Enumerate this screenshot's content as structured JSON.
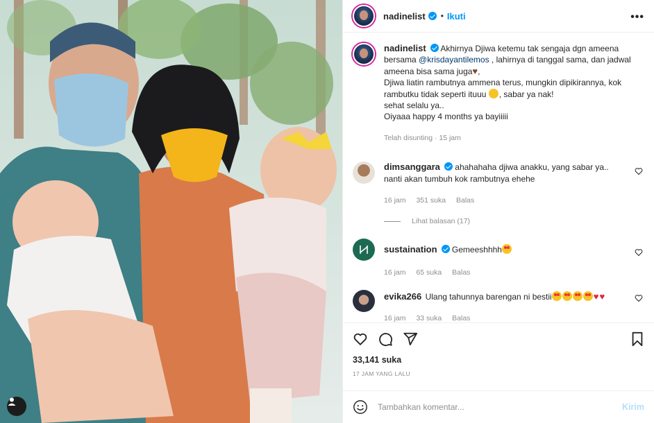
{
  "post": {
    "username": "nadinelist",
    "follow_label": "Ikuti",
    "separator": "•",
    "more_label": "•••"
  },
  "caption": {
    "username": "nadinelist",
    "text_1": "Akhirnya Djiwa ketemu tak sengaja dgn ameena bersama ",
    "mention": "@krisdayantilemos",
    "text_2": " , lahirnya di tanggal sama, dan jadwal ameena bisa sama juga",
    "line_2_a": "Djiwa liatin rambutnya ammena terus, mungkin dipikirannya, kok rambutku tidak seperti ituuu ",
    "line_2_b": ", sabar ya nak!",
    "line_3": "sehat selalu ya..",
    "line_4": "Oiyaaa happy 4 months ya bayiiiii",
    "edited": "Telah disunting · 15 jam"
  },
  "comments": [
    {
      "username": "dimsanggara",
      "verified": true,
      "text": "ahahahaha djiwa anakku, yang sabar ya.. nanti akan tumbuh kok rambutnya ehehe",
      "time": "16 jam",
      "likes": "351 suka",
      "reply": "Balas",
      "view_replies": "Lihat balasan (17)"
    },
    {
      "username": "sustaination",
      "verified": true,
      "text": "Gemeeshhhh",
      "time": "16 jam",
      "likes": "65 suka",
      "reply": "Balas"
    },
    {
      "username": "evika266",
      "verified": false,
      "text": "Ulang tahunnya barengan ni bestii",
      "time": "16 jam",
      "likes": "33 suka",
      "reply": "Balas"
    }
  ],
  "stats": {
    "likes": "33,141 suka",
    "posted": "17 JAM YANG LALU"
  },
  "add_comment": {
    "placeholder": "Tambahkan komentar...",
    "send_label": "Kirim"
  },
  "icons": {
    "like": "heart-icon",
    "comment": "comment-icon",
    "share": "send-icon",
    "save": "bookmark-icon",
    "emoji": "emoji-icon",
    "tag": "user-tag-icon"
  },
  "colors": {
    "accent": "#0095f6",
    "mention": "#00376b",
    "meta": "#8e8e8e",
    "send_disabled": "#b2dffc"
  }
}
